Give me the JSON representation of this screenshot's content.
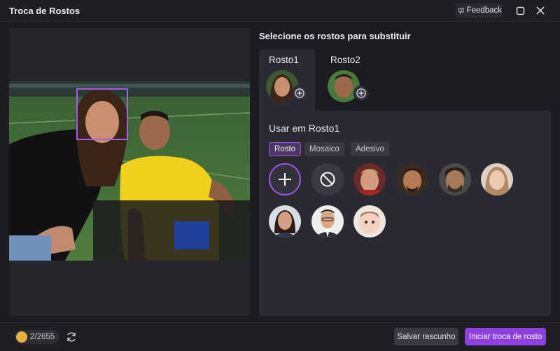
{
  "window": {
    "title": "Troca de Rostos",
    "feedback_label": "Feedback"
  },
  "selection": {
    "heading": "Selecione os rostos para substituir",
    "tabs": [
      {
        "label": "Rosto1",
        "active": true
      },
      {
        "label": "Rosto2",
        "active": false
      }
    ]
  },
  "panel": {
    "use_label": "Usar em Rosto1",
    "chips": [
      {
        "label": "Rosto",
        "active": true
      },
      {
        "label": "Mosaico",
        "active": false
      },
      {
        "label": "Adesivo",
        "active": false
      }
    ]
  },
  "footer": {
    "credits": "2/2655",
    "save_label": "Salvar rascunho",
    "start_label": "Iniciar troca de rosto"
  },
  "colors": {
    "accent": "#8d3fe0",
    "face_highlight": "#a45ee8"
  }
}
